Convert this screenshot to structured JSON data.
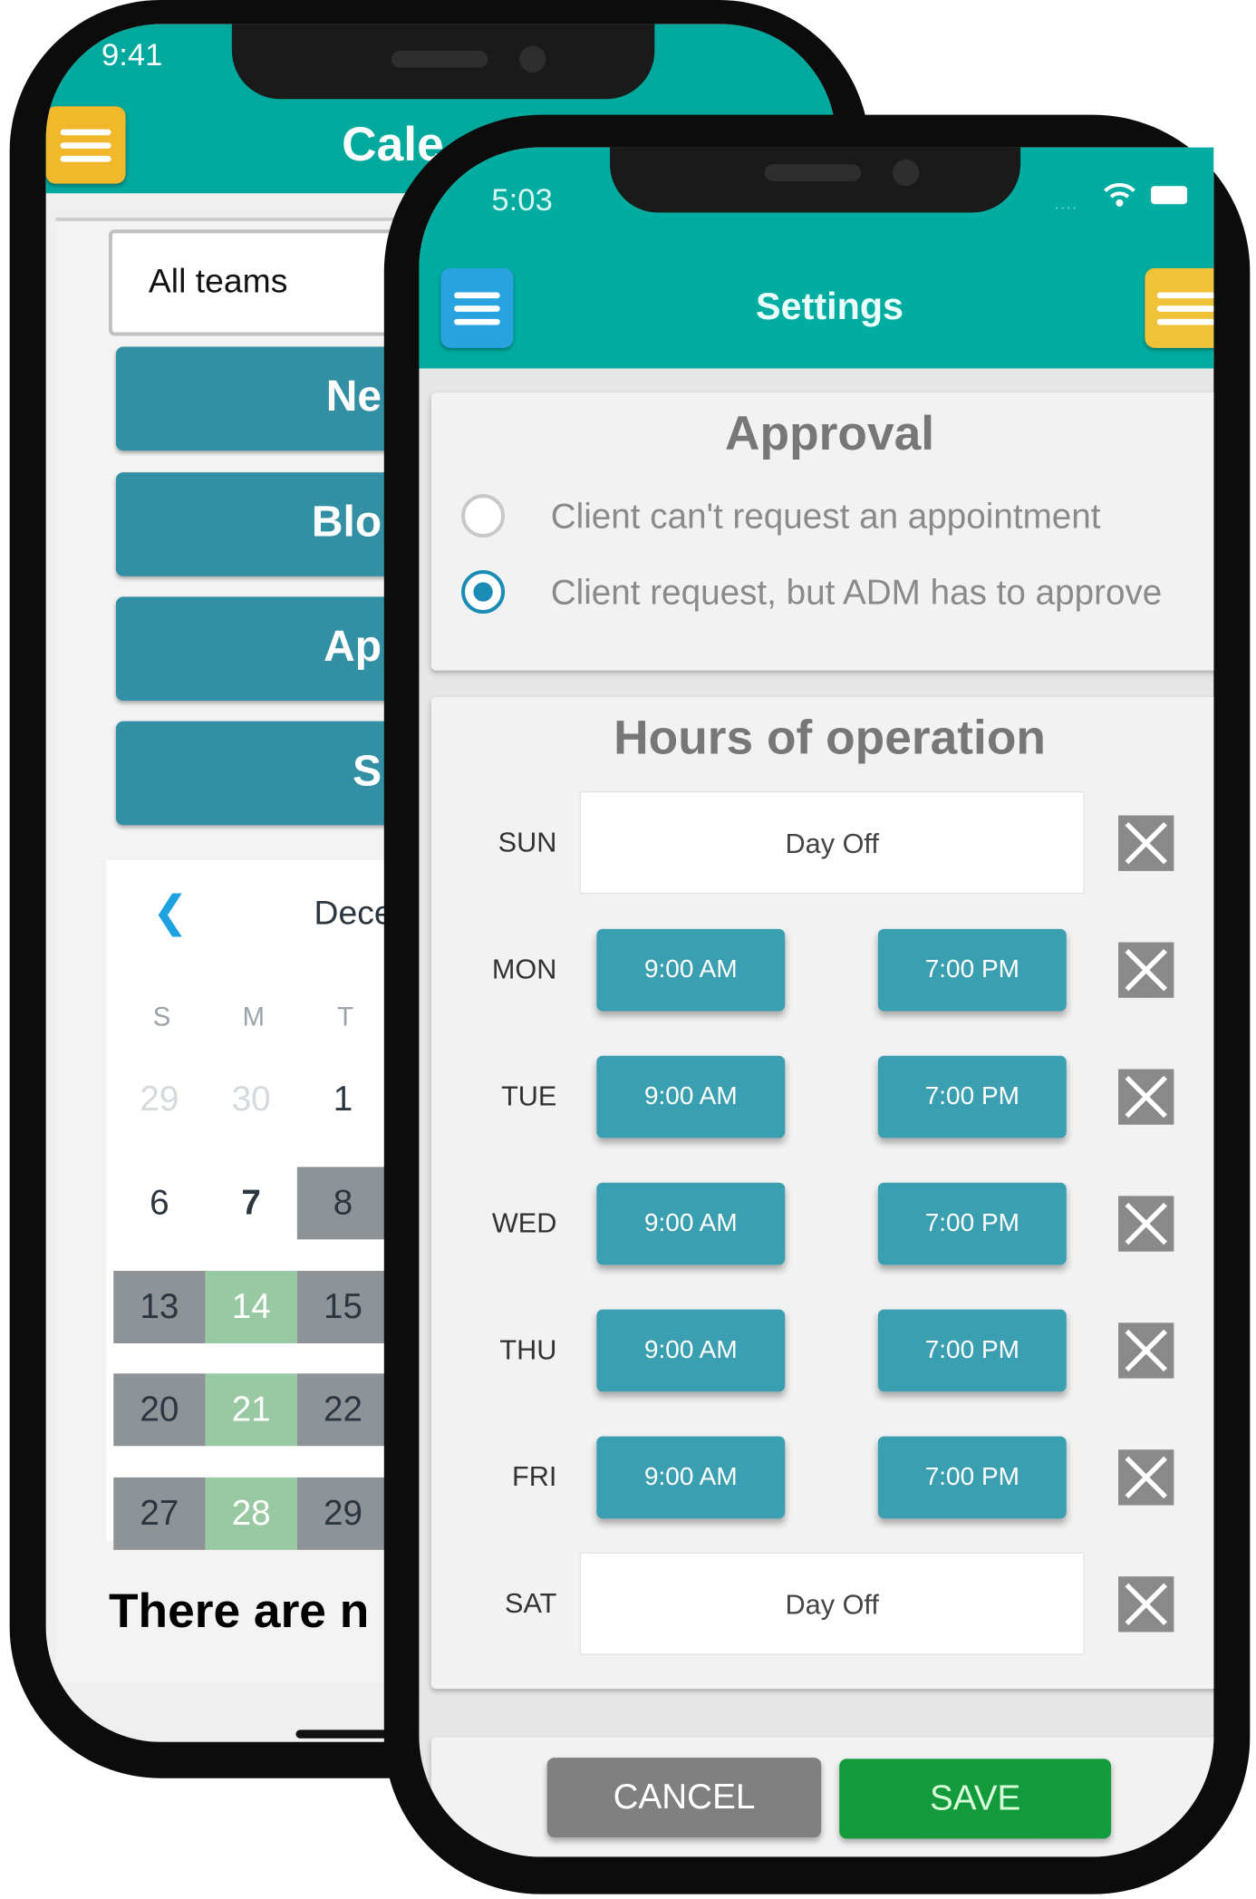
{
  "back_phone": {
    "status_time": "9:41",
    "header_title": "Cale",
    "team_select": "All teams",
    "buttons": [
      "Ne",
      "Blo",
      "Ap",
      "S"
    ],
    "calendar": {
      "month": "Dece",
      "weekdays": [
        "S",
        "M",
        "T"
      ],
      "rows": [
        [
          {
            "d": "29",
            "state": "muted"
          },
          {
            "d": "30",
            "state": "muted"
          },
          {
            "d": "1",
            "state": "normal"
          }
        ],
        [
          {
            "d": "6",
            "state": "normal"
          },
          {
            "d": "7",
            "state": "today"
          },
          {
            "d": "8",
            "state": "gray"
          }
        ],
        [
          {
            "d": "13",
            "state": "gray"
          },
          {
            "d": "14",
            "state": "green"
          },
          {
            "d": "15",
            "state": "gray"
          }
        ],
        [
          {
            "d": "20",
            "state": "gray"
          },
          {
            "d": "21",
            "state": "green"
          },
          {
            "d": "22",
            "state": "gray"
          }
        ],
        [
          {
            "d": "27",
            "state": "gray"
          },
          {
            "d": "28",
            "state": "green"
          },
          {
            "d": "29",
            "state": "gray"
          }
        ]
      ]
    },
    "empty_message": "There are n"
  },
  "front_phone": {
    "status_time": "5:03",
    "header_title": "Settings",
    "approval": {
      "title": "Approval",
      "options": [
        {
          "label": "Client can't request an appointment",
          "selected": false
        },
        {
          "label": "Client request, but ADM has to approve",
          "selected": true
        }
      ]
    },
    "hours": {
      "title": "Hours of operation",
      "days": [
        {
          "day": "SUN",
          "off": true,
          "label": "Day Off"
        },
        {
          "day": "MON",
          "off": false,
          "open": "9:00 AM",
          "close": "7:00 PM"
        },
        {
          "day": "TUE",
          "off": false,
          "open": "9:00 AM",
          "close": "7:00 PM"
        },
        {
          "day": "WED",
          "off": false,
          "open": "9:00 AM",
          "close": "7:00 PM"
        },
        {
          "day": "THU",
          "off": false,
          "open": "9:00 AM",
          "close": "7:00 PM"
        },
        {
          "day": "FRI",
          "off": false,
          "open": "9:00 AM",
          "close": "7:00 PM"
        },
        {
          "day": "SAT",
          "off": true,
          "label": "Day Off"
        }
      ]
    },
    "cancel_label": "CANCEL",
    "save_label": "SAVE"
  },
  "colors": {
    "teal": "#00a99d",
    "yellow": "#f0b82a",
    "blue": "#29a3e0",
    "time_button": "#3a9fb1",
    "save": "#139a3a",
    "cancel": "#808080",
    "cal_gray": "#8e9397",
    "cal_green": "#98c9a3"
  }
}
